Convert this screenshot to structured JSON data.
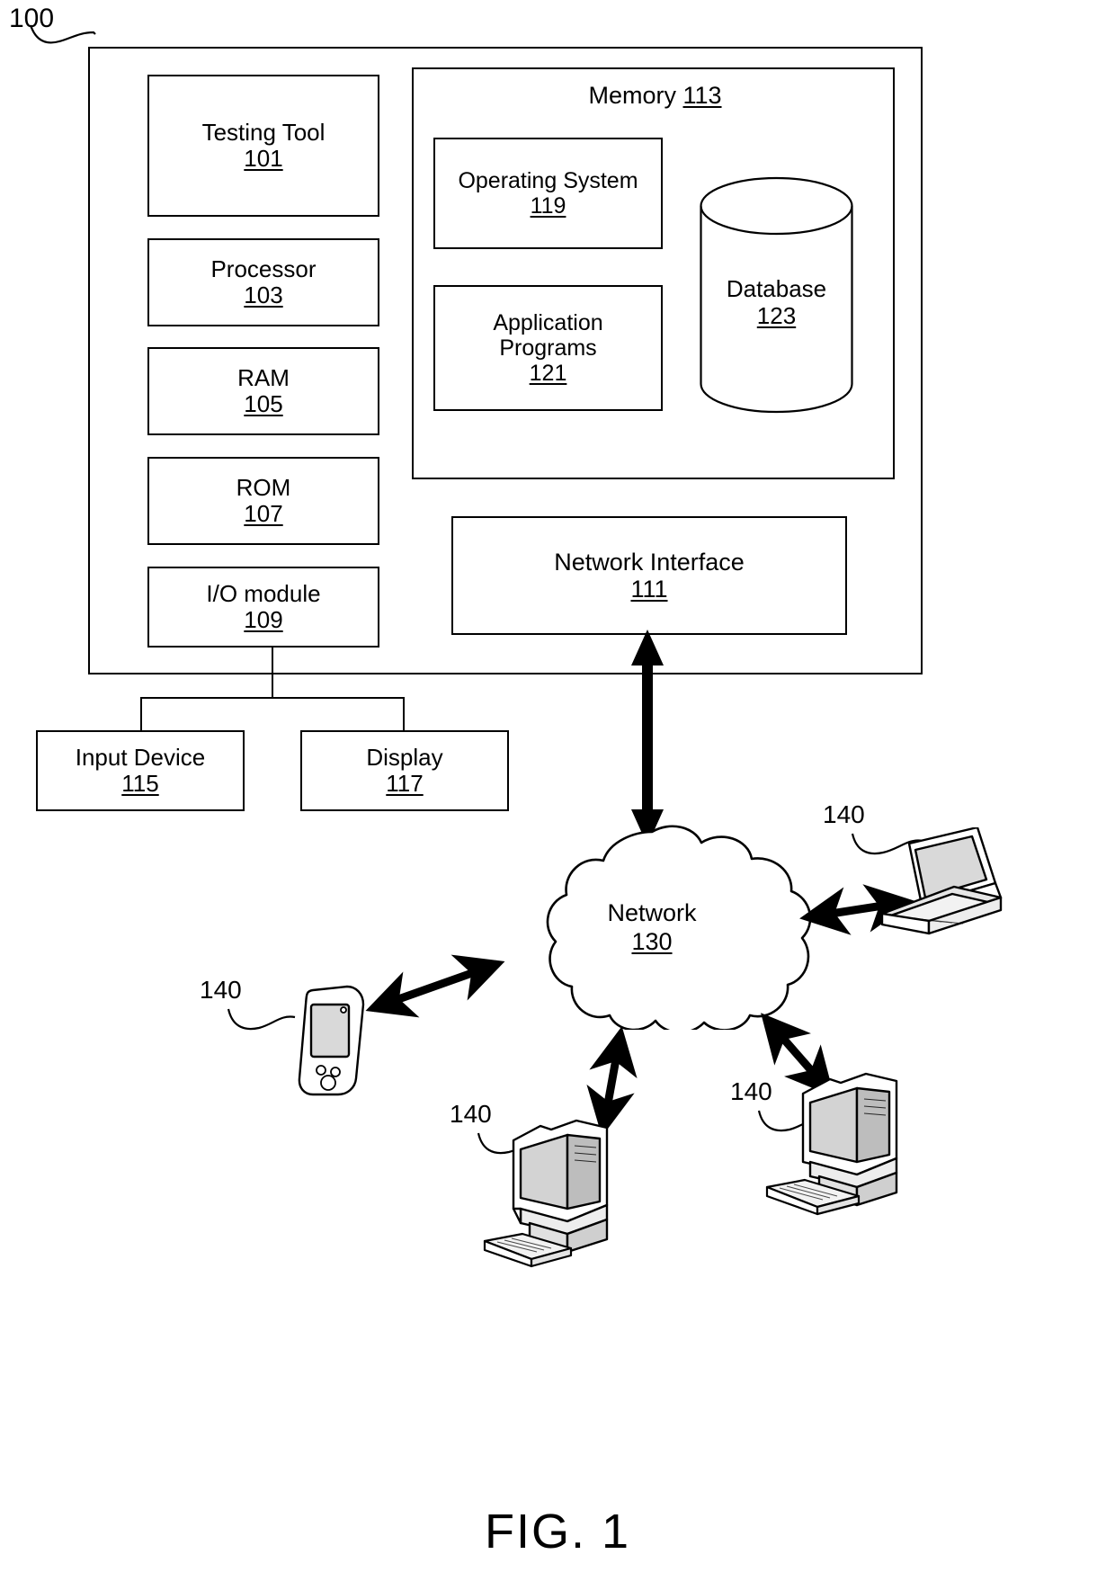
{
  "figure": {
    "caption": "FIG. 1",
    "system_ref": "100"
  },
  "system": {
    "components": [
      {
        "label": "Testing Tool",
        "num": "101"
      },
      {
        "label": "Processor",
        "num": "103"
      },
      {
        "label": "RAM",
        "num": "105"
      },
      {
        "label": "ROM",
        "num": "107"
      },
      {
        "label": "I/O module",
        "num": "109"
      }
    ],
    "memory": {
      "label": "Memory",
      "num": "113",
      "items": [
        {
          "label": "Operating System",
          "num": "119"
        },
        {
          "label": "Application\nPrograms",
          "num": "121"
        }
      ],
      "database": {
        "label": "Database",
        "num": "123"
      }
    },
    "network_interface": {
      "label": "Network Interface",
      "num": "111"
    },
    "peripherals": [
      {
        "label": "Input Device",
        "num": "115"
      },
      {
        "label": "Display",
        "num": "117"
      }
    ]
  },
  "network": {
    "label": "Network",
    "num": "130",
    "terminal_ref": "140",
    "terminals": [
      {
        "type": "laptop",
        "ref": "140"
      },
      {
        "type": "mobile-phone",
        "ref": "140"
      },
      {
        "type": "desktop-computer",
        "ref": "140"
      },
      {
        "type": "desktop-computer",
        "ref": "140"
      }
    ]
  }
}
